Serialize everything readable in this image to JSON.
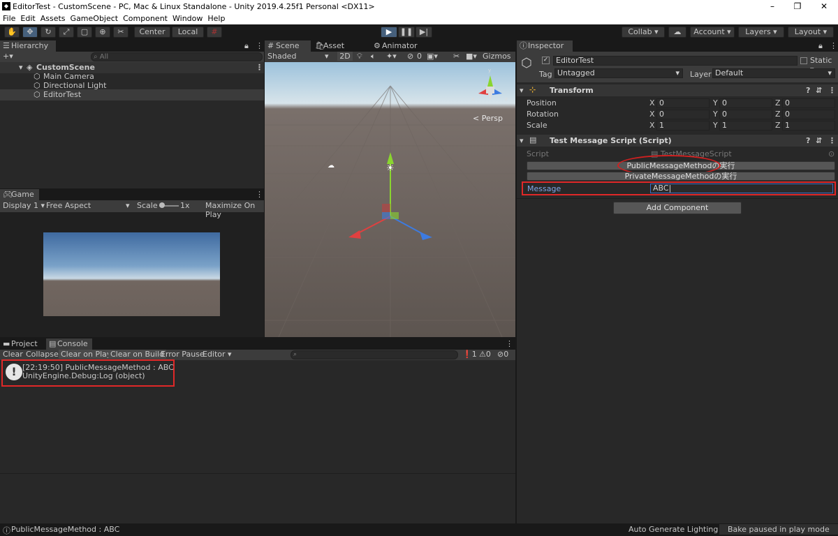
{
  "window": {
    "title": "EditorTest - CustomScene - PC, Mac & Linux Standalone - Unity 2019.4.25f1 Personal <DX11>",
    "controls": [
      "–",
      "❐",
      "✕"
    ]
  },
  "menu": [
    "File",
    "Edit",
    "Assets",
    "GameObject",
    "Component",
    "Window",
    "Help"
  ],
  "toolbar": {
    "center": "Center",
    "local": "Local",
    "collab": "Collab",
    "account": "Account",
    "layers": "Layers",
    "layout": "Layout"
  },
  "hierarchy": {
    "tab": "Hierarchy",
    "search_placeholder": "All",
    "scene": "CustomScene",
    "items": [
      "Main Camera",
      "Directional Light",
      "EditorTest"
    ]
  },
  "scene_view": {
    "tabs": [
      "Scene",
      "Asset Store",
      "Animator"
    ],
    "shading": "Shaded",
    "mode2d": "2D",
    "hidden_count": "0",
    "gizmos": "Gizmos",
    "persp": "Persp"
  },
  "game_view": {
    "tab": "Game",
    "display": "Display 1",
    "aspect": "Free Aspect",
    "scale_label": "Scale",
    "scale_value": "1x",
    "maximize": "Maximize On Play"
  },
  "inspector": {
    "tab": "Inspector",
    "object_name": "EditorTest",
    "static_label": "Static",
    "tag_label": "Tag",
    "tag_value": "Untagged",
    "layer_label": "Layer",
    "layer_value": "Default",
    "transform": {
      "title": "Transform",
      "rows": [
        {
          "label": "Position",
          "x": "0",
          "y": "0",
          "z": "0"
        },
        {
          "label": "Rotation",
          "x": "0",
          "y": "0",
          "z": "0"
        },
        {
          "label": "Scale",
          "x": "1",
          "y": "1",
          "z": "1"
        }
      ]
    },
    "script_component": {
      "title": "Test Message Script (Script)",
      "script_label": "Script",
      "script_value": "TestMessageScript",
      "public_button": "PublicMessageMethodの実行",
      "private_button": "PrivateMessageMethodの実行",
      "message_label": "Message",
      "message_value": "ABC"
    },
    "add_component": "Add Component"
  },
  "console": {
    "tabs": [
      "Project",
      "Console"
    ],
    "buttons": [
      "Clear",
      "Collapse",
      "Clear on Play",
      "Clear on Build",
      "Error Pause",
      "Editor"
    ],
    "counts": {
      "info": "1",
      "warn": "0",
      "error": "0"
    },
    "log_line1": "[22:19:50] PublicMessageMethod : ABC",
    "log_line2": "UnityEngine.Debug:Log (object)"
  },
  "statusbar": {
    "message": "PublicMessageMethod : ABC",
    "lighting": "Auto Generate Lighting Off",
    "bake": "Bake paused in play mode"
  }
}
